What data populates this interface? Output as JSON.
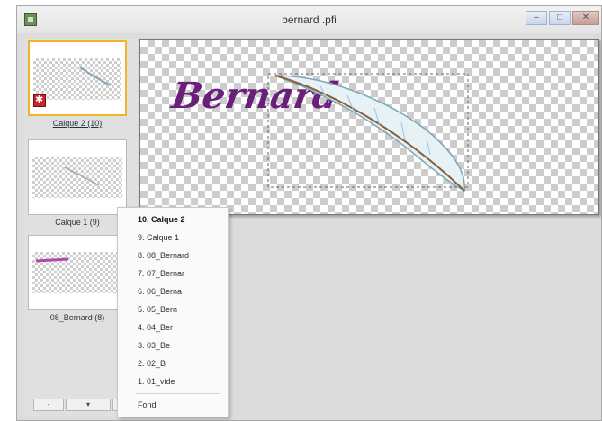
{
  "window": {
    "title": "bernard .pfi"
  },
  "layers_panel": {
    "thumbnails": [
      {
        "label": "Calque 2 (10)",
        "selected": true
      },
      {
        "label": "Calque 1 (9)",
        "selected": false
      },
      {
        "label": "08_Bernard (8)",
        "selected": false
      }
    ],
    "scroll_buttons": [
      "-",
      "▾",
      "▸"
    ]
  },
  "canvas": {
    "text": "Bernard"
  },
  "layer_menu": {
    "items": [
      "10. Calque 2",
      "9. Calque 1",
      "8. 08_Bernard",
      "7. 07_Bernar",
      "6. 06_Berna",
      "5. 05_Bern",
      "4. 04_Ber",
      "3. 03_Be",
      "2. 02_B",
      "1. 01_vide"
    ],
    "background_item": "Fond"
  },
  "colors": {
    "selection": "#f0b429",
    "text_purple": "#6a1f7a"
  }
}
